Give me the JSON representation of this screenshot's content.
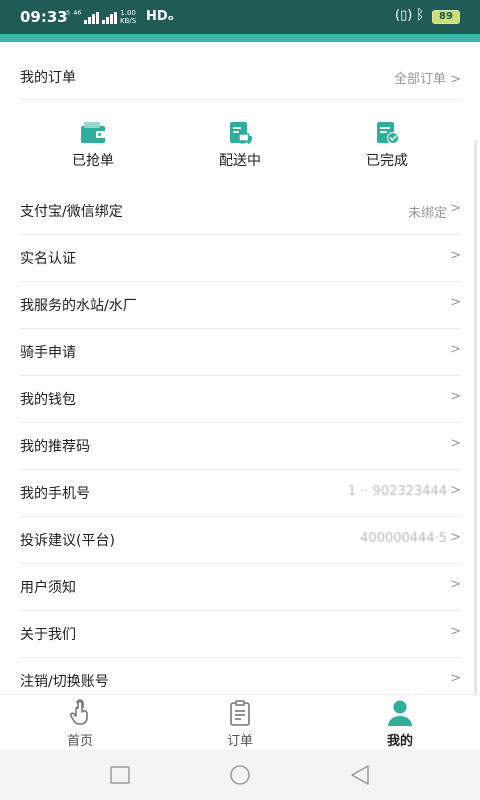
{
  "status_bar": {
    "time": "09:33",
    "network": "⁵ ⁴⁶",
    "speed_value": "1.00",
    "speed_unit": "KB/S",
    "hd": "HDₒ",
    "battery": "89",
    "bg_color": "#1f5c56",
    "accent_color": "#37bba8"
  },
  "orders": {
    "title": "我的订单",
    "all_orders": "全部订单 >",
    "statuses": [
      {
        "label": "已抢单",
        "icon": "wallet-icon"
      },
      {
        "label": "配送中",
        "icon": "delivery-truck-icon"
      },
      {
        "label": "已完成",
        "icon": "completed-check-icon"
      }
    ],
    "icon_color": "#2fae9b"
  },
  "menu": [
    {
      "label": "支付宝/微信绑定",
      "value": "未绑定"
    },
    {
      "label": "实名认证",
      "value": ""
    },
    {
      "label": "我服务的水站/水厂",
      "value": ""
    },
    {
      "label": "骑手申请",
      "value": ""
    },
    {
      "label": "我的钱包",
      "value": ""
    },
    {
      "label": "我的推荐码",
      "value": ""
    },
    {
      "label": "我的手机号",
      "value": "1 ·· 902323444"
    },
    {
      "label": "投诉建议(平台)",
      "value": "400000444·5"
    },
    {
      "label": "用户须知",
      "value": ""
    },
    {
      "label": "关于我们",
      "value": ""
    },
    {
      "label": "注销/切换账号",
      "value": ""
    }
  ],
  "chevron": ">",
  "tabs": [
    {
      "label": "首页",
      "icon": "hand-tap-icon",
      "active": false
    },
    {
      "label": "订单",
      "icon": "clipboard-icon",
      "active": false
    },
    {
      "label": "我的",
      "icon": "person-icon",
      "active": true
    }
  ]
}
